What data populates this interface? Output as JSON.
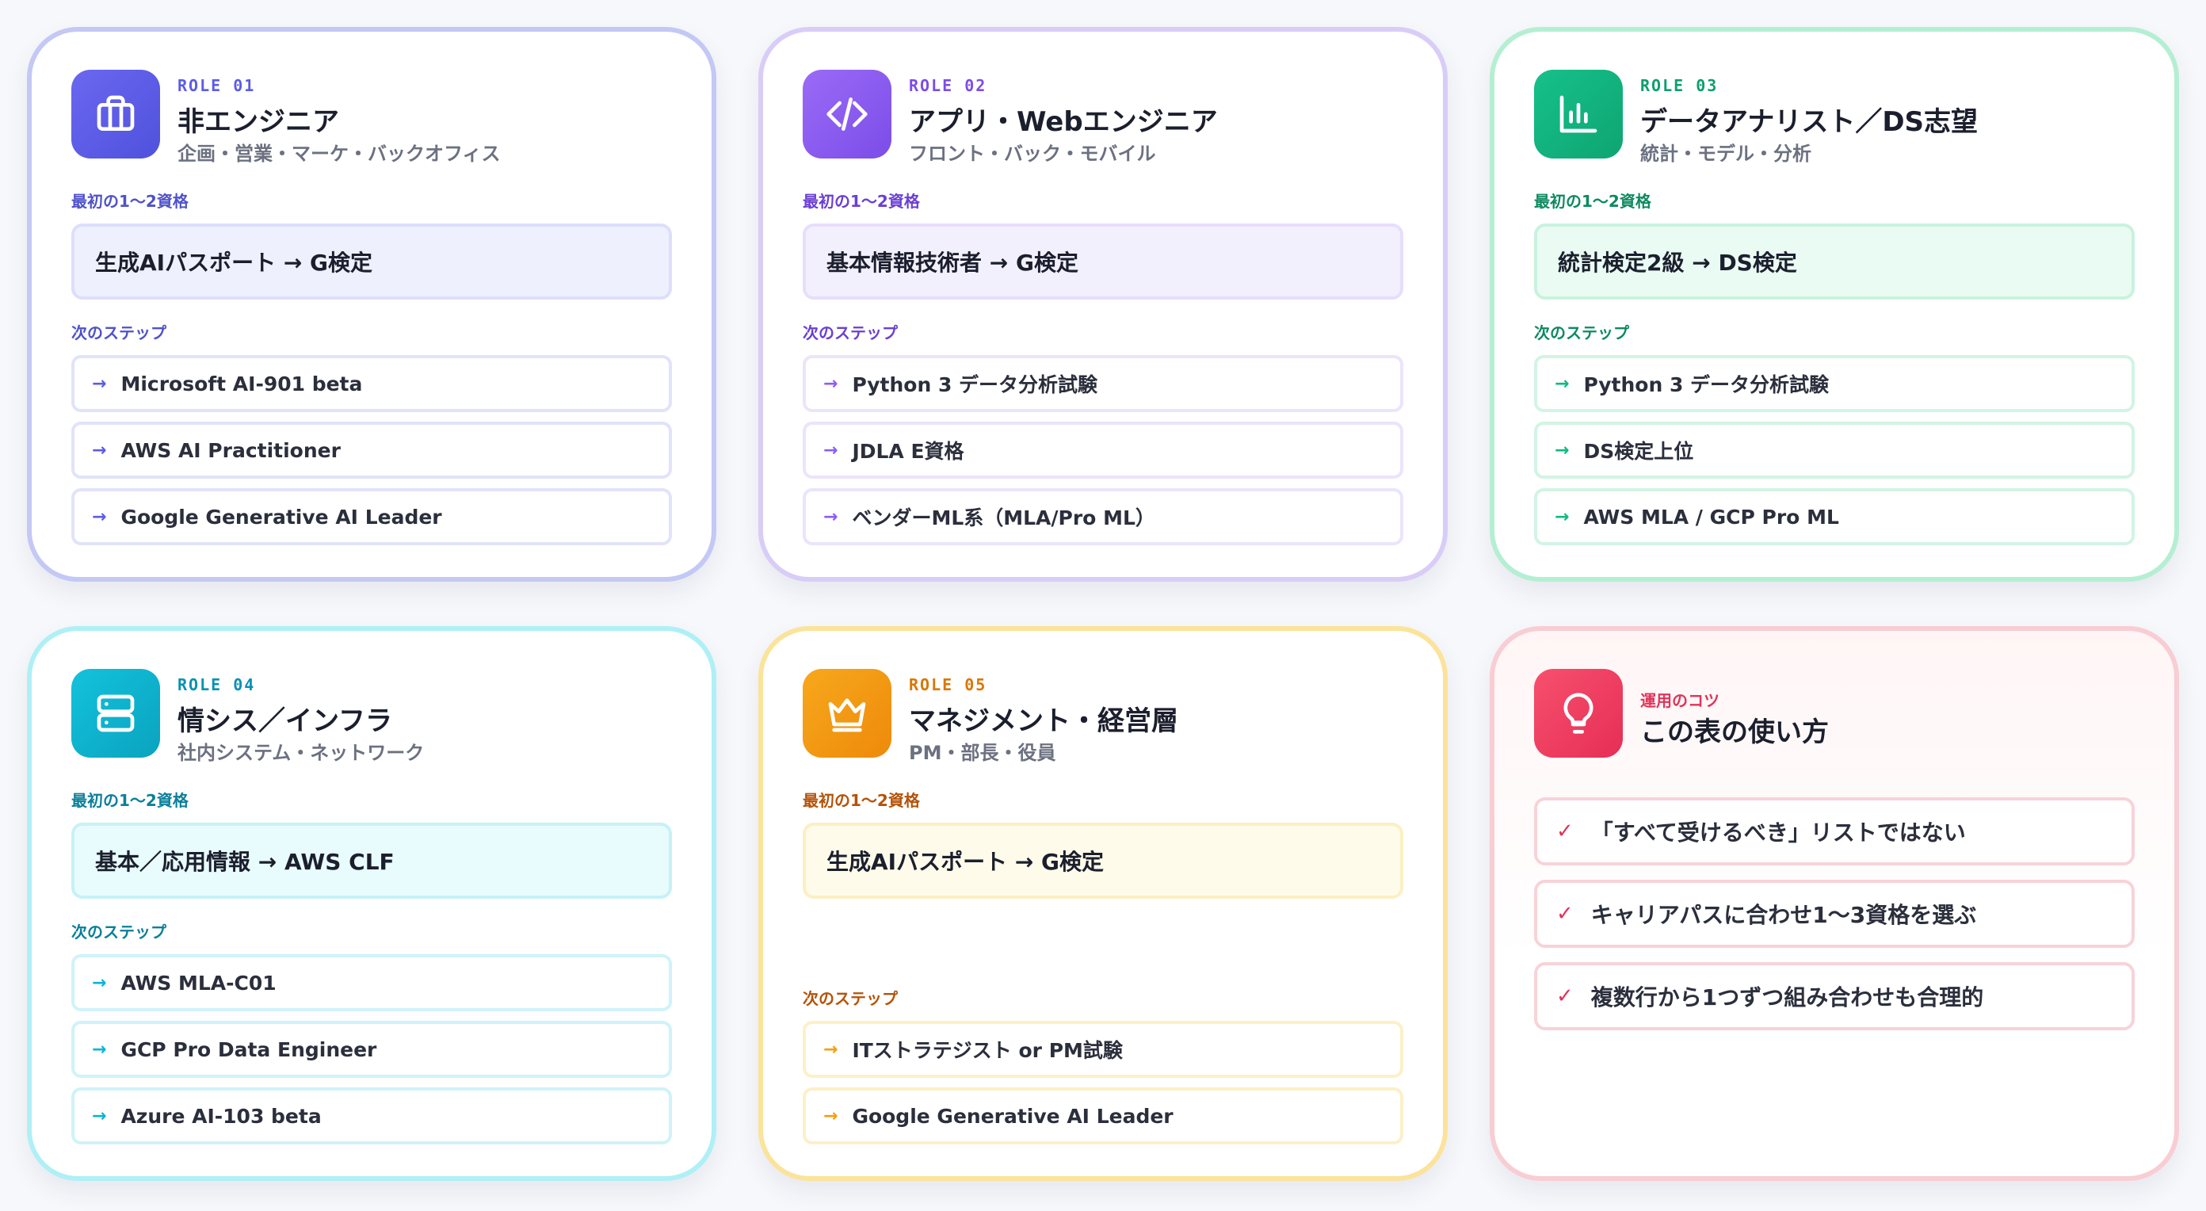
{
  "labels": {
    "first": "最初の1〜2資格",
    "next": "次のステップ"
  },
  "roles": [
    {
      "tag": "ROLE 01",
      "title": "非エンジニア",
      "subtitle": "企画・営業・マーケ・バックオフィス",
      "icon": "briefcase-icon",
      "accent": "#5b5ce6",
      "first": "生成AIパスポート → G検定",
      "next": [
        "Microsoft AI-901 beta",
        "AWS AI Practitioner",
        "Google Generative AI Leader"
      ]
    },
    {
      "tag": "ROLE 02",
      "title": "アプリ・Webエンジニア",
      "subtitle": "フロント・バック・モバイル",
      "icon": "code-icon",
      "accent": "#8b5cf6",
      "first": "基本情報技術者 → G検定",
      "next": [
        "Python 3 データ分析試験",
        "JDLA E資格",
        "ベンダーML系（MLA/Pro ML）"
      ]
    },
    {
      "tag": "ROLE 03",
      "title": "データアナリスト／DS志望",
      "subtitle": "統計・モデル・分析",
      "icon": "bar-chart-icon",
      "accent": "#10b981",
      "first": "統計検定2級 → DS検定",
      "next": [
        "Python 3 データ分析試験",
        "DS検定上位",
        "AWS MLA / GCP Pro ML"
      ]
    },
    {
      "tag": "ROLE 04",
      "title": "情シス／インフラ",
      "subtitle": "社内システム・ネットワーク",
      "icon": "server-icon",
      "accent": "#06b6d4",
      "first": "基本／応用情報 → AWS CLF",
      "next": [
        "AWS MLA-C01",
        "GCP Pro Data Engineer",
        "Azure AI-103 beta"
      ]
    },
    {
      "tag": "ROLE 05",
      "title": "マネジメント・経営層",
      "subtitle": "PM・部長・役員",
      "icon": "crown-icon",
      "accent": "#f59e0b",
      "first": "生成AIパスポート → G検定",
      "next": [
        "ITストラテジスト or PM試験",
        "Google Generative AI Leader"
      ]
    }
  ],
  "tips": {
    "tag": "運用のコツ",
    "title": "この表の使い方",
    "icon": "lightbulb-icon",
    "accent": "#f43f5e",
    "items": [
      "「すべて受けるべき」リストではない",
      "キャリアパスに合わせ1〜3資格を選ぶ",
      "複数行から1つずつ組み合わせも合理的"
    ]
  }
}
